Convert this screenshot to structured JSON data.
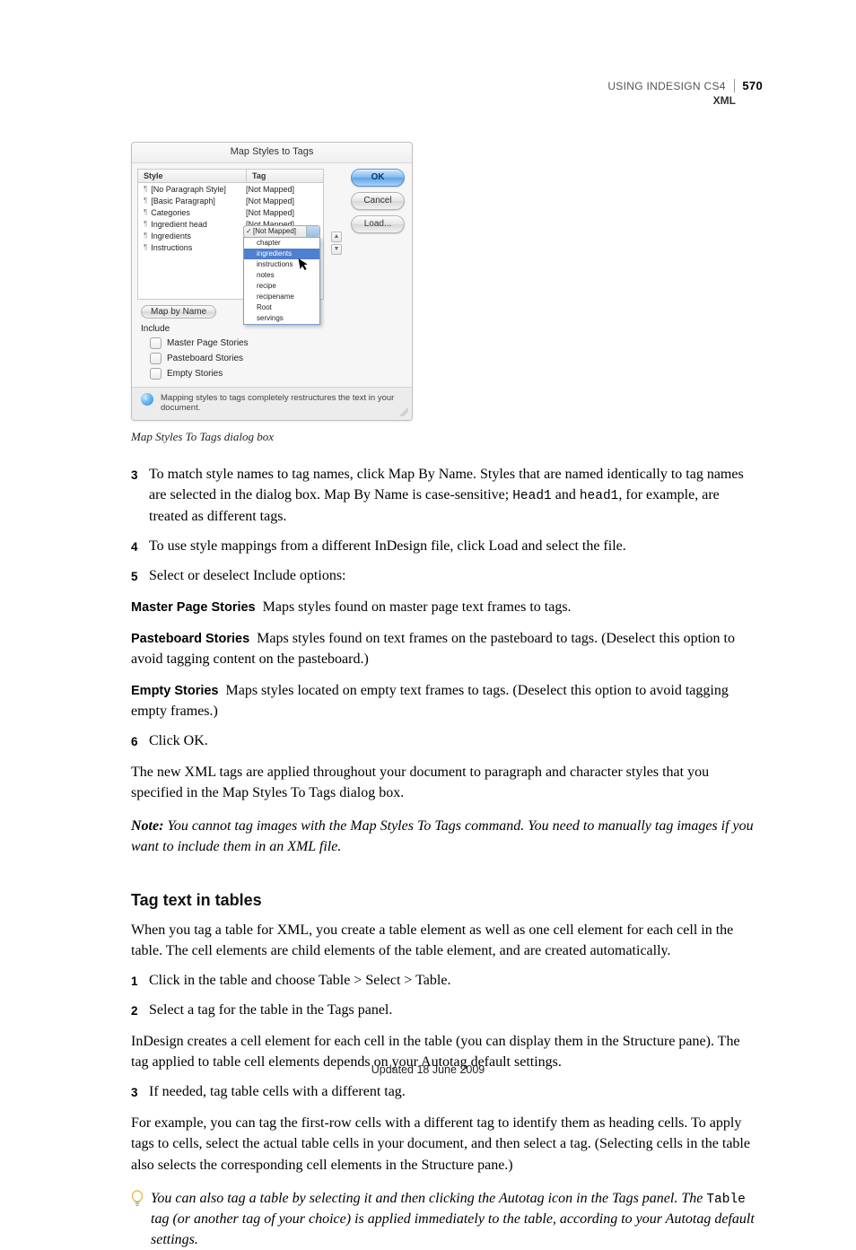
{
  "header": {
    "doc_title": "USING INDESIGN CS4",
    "page_number": "570",
    "section": "XML"
  },
  "dialog": {
    "title": "Map Styles to Tags",
    "col_style": "Style",
    "col_tag": "Tag",
    "rows": [
      {
        "style": "[No Paragraph Style]",
        "tag": "[Not Mapped]"
      },
      {
        "style": "[Basic Paragraph]",
        "tag": "[Not Mapped]"
      },
      {
        "style": "Categories",
        "tag": "[Not Mapped]"
      },
      {
        "style": "Ingredient head",
        "tag": "[Not Mapped]"
      },
      {
        "style": "Ingredients",
        "tag": ""
      },
      {
        "style": "Instructions",
        "tag": ""
      }
    ],
    "dropdown_selected": "[Not Mapped]",
    "dropdown_options": [
      "chapter",
      "ingredients",
      "instructions",
      "notes",
      "recipe",
      "recipename",
      "Root",
      "servings"
    ],
    "dropdown_highlight_index": 1,
    "map_by_name": "Map by Name",
    "include_label": "Include",
    "chk_master": "Master Page Stories",
    "chk_pasteboard": "Pasteboard Stories",
    "chk_empty": "Empty Stories",
    "btn_ok": "OK",
    "btn_cancel": "Cancel",
    "btn_load": "Load...",
    "footer_msg": "Mapping styles to tags completely restructures the text in your document."
  },
  "caption": "Map Styles To Tags dialog box",
  "steps1": {
    "n3": "3",
    "t3a": "To match style names to tag names, click Map By Name. Styles that are named identically to tag names are selected in the dialog box. Map By Name is case-sensitive; ",
    "t3code1": "Head1",
    "t3mid": " and ",
    "t3code2": "head1",
    "t3b": ", for example, are treated as different tags.",
    "n4": "4",
    "t4": "To use style mappings from a different InDesign file, click Load and select the file.",
    "n5": "5",
    "t5": "Select or deselect Include options:"
  },
  "runin": {
    "master_l": "Master Page Stories",
    "master_t": "Maps styles found on master page text frames to tags.",
    "paste_l": "Pasteboard Stories",
    "paste_t": "Maps styles found on text frames on the pasteboard to tags. (Deselect this option to avoid tagging content on the pasteboard.)",
    "empty_l": "Empty Stories",
    "empty_t": "Maps styles located on empty text frames to tags. (Deselect this option to avoid tagging empty frames.)"
  },
  "steps2": {
    "n6": "6",
    "t6": "Click OK."
  },
  "para_after": "The new XML tags are applied throughout your document to paragraph and character styles that you specified in the Map Styles To Tags dialog box.",
  "note": {
    "label": "Note:",
    "text": " You cannot tag images with the Map Styles To Tags command. You need to manually tag images if you want to include them in an XML file."
  },
  "h2": "Tag text in tables",
  "tables_intro": "When you tag a table for XML, you create a table element as well as one cell element for each cell in the table. The cell elements are child elements of the table element, and are created automatically.",
  "tsteps": {
    "n1": "1",
    "t1": "Click in the table and choose Table > Select > Table.",
    "n2": "2",
    "t2": "Select a tag for the table in the Tags panel."
  },
  "tpara1": "InDesign creates a cell element for each cell in the table (you can display them in the Structure pane). The tag applied to table cell elements depends on your Autotag default settings.",
  "tsteps2": {
    "n3": "3",
    "t3": "If needed, tag table cells with a different tag."
  },
  "tpara2": "For example, you can tag the first-row cells with a different tag to identify them as heading cells. To apply tags to cells, select the actual table cells in your document, and then select a tag. (Selecting cells in the table also selects the corresponding cell elements in the Structure pane.)",
  "tip": {
    "t_a": "You can also tag a table by selecting it and then clicking the Autotag icon in the Tags panel. The ",
    "t_code": "Table",
    "t_b": " tag (or another tag of your choice) is applied immediately to the table, according to your Autotag default settings."
  },
  "footer": "Updated 18 June 2009"
}
